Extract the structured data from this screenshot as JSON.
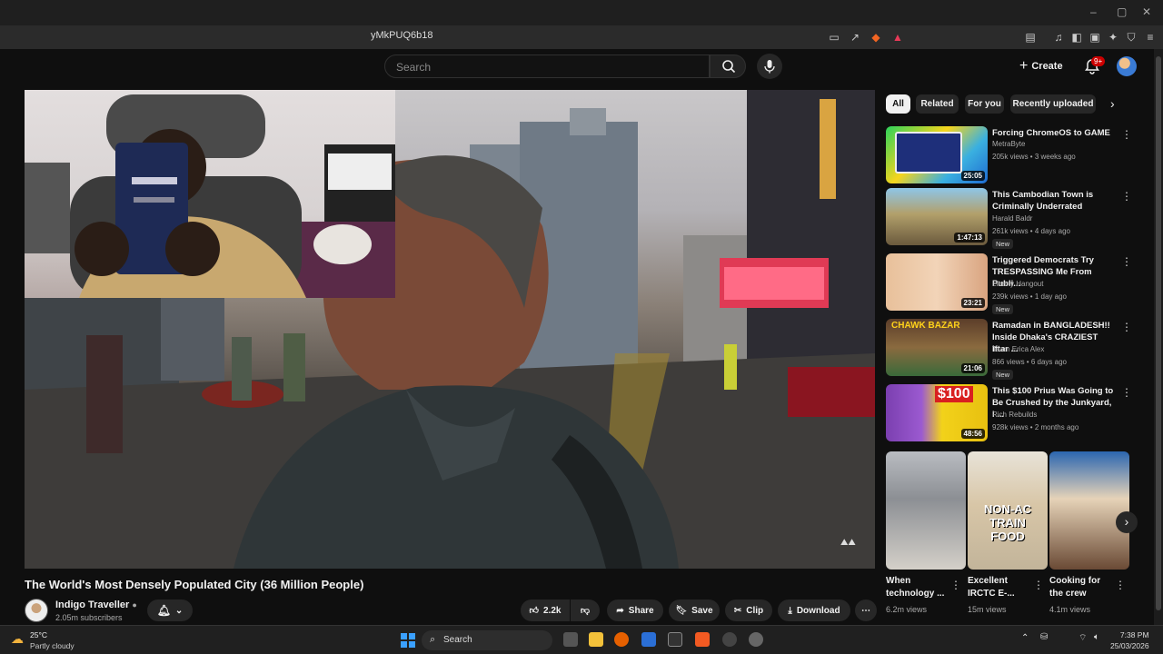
{
  "browser": {
    "url_fragment": "yMkPUQ6b18"
  },
  "header": {
    "search_placeholder": "Search",
    "create_label": "Create",
    "notification_count": "9+"
  },
  "video": {
    "title": "The World's Most Densely Populated City (36 Million People)",
    "channel": "Indigo Traveller",
    "subscribers": "2.05m subscribers",
    "likes": "2.2k",
    "actions": [
      "Share",
      "Save",
      "Clip",
      "Download"
    ]
  },
  "filters": [
    "All",
    "Related",
    "For you",
    "Recently uploaded"
  ],
  "recommendations": [
    {
      "title": "Forcing ChromeOS to GAME",
      "channel": "MetraByte",
      "meta": "205k views • 3 weeks ago",
      "duration": "25:05",
      "badge": ""
    },
    {
      "title": "This Cambodian Town is Criminally Underrated",
      "channel": "Harald Baldr",
      "meta": "261k views • 4 days ago",
      "duration": "1:47:13",
      "badge": "New"
    },
    {
      "title": "Triggered Democrats Try TRESPASSING Me From Publi...",
      "channel": "Liberty Hangout",
      "meta": "239k views • 1 day ago",
      "duration": "23:21",
      "badge": "New"
    },
    {
      "title": "Ramadan in BANGLADESH!! Inside Dhaka's CRAZIEST Iftar ...",
      "channel": "Team Erica Alex",
      "meta": "866 views • 6 days ago",
      "duration": "21:06",
      "badge": "New"
    },
    {
      "title": "This $100 Prius Was Going to Be Crushed by the Junkyard, I ...",
      "channel": "Rich Rebuilds",
      "meta": "928k views • 2 months ago",
      "duration": "48:56",
      "badge": ""
    }
  ],
  "shorts": [
    {
      "title": "When technology ...",
      "views": "6.2m views",
      "overlay": ""
    },
    {
      "title": "Excellent IRCTC E-...",
      "views": "15m views",
      "overlay": "NON-AC TRAIN FOOD"
    },
    {
      "title": "Cooking for the crew",
      "views": "4.1m views",
      "overlay": ""
    }
  ],
  "thumb_overlays": {
    "r4": "CHAWK BAZAR",
    "r5": "$100"
  },
  "taskbar": {
    "weather_temp": "25°C",
    "weather_desc": "Partly cloudy",
    "search_label": "Search",
    "time": "7:38 PM",
    "date": "25/03/2026"
  }
}
